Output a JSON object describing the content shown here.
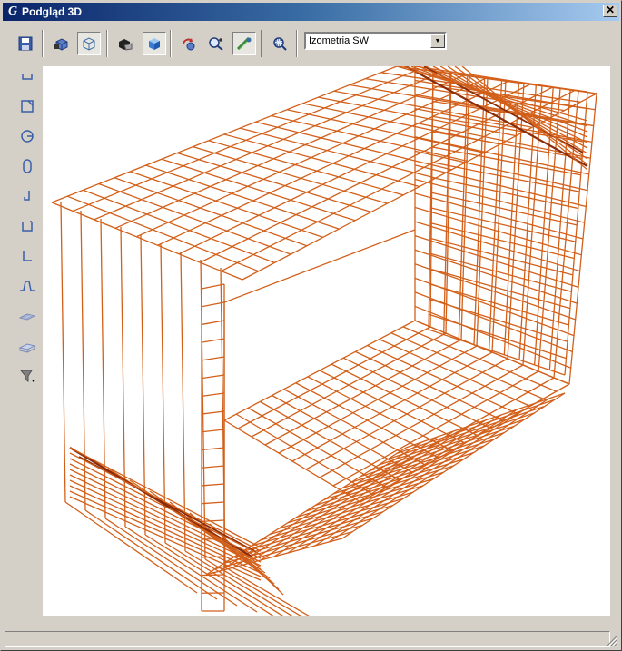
{
  "window": {
    "title": "Podgląd 3D",
    "app_icon_glyph": "G"
  },
  "toolbar": {
    "buttons": [
      {
        "name": "save-icon"
      },
      {
        "name": "view-open-icon"
      },
      {
        "name": "wireframe-cube-icon",
        "pressed": true
      },
      {
        "name": "render-mode-icon"
      },
      {
        "name": "shaded-cube-icon",
        "pressed": true
      },
      {
        "name": "rotate-view-icon"
      },
      {
        "name": "zoom-in-out-icon"
      },
      {
        "name": "pan-hand-icon",
        "pressed": true
      },
      {
        "name": "zoom-extents-icon"
      }
    ],
    "view_select": {
      "value": "Izometria SW"
    }
  },
  "left_tools": [
    {
      "name": "shape-u-icon"
    },
    {
      "name": "shape-square-icon"
    },
    {
      "name": "shape-circle-icon"
    },
    {
      "name": "shape-oval-icon"
    },
    {
      "name": "shape-j-icon"
    },
    {
      "name": "shape-open-square-icon"
    },
    {
      "name": "shape-l-icon"
    },
    {
      "name": "shape-wave-icon"
    },
    {
      "name": "mesh-flat-icon"
    },
    {
      "name": "mesh-3d-icon"
    },
    {
      "name": "filter-icon"
    }
  ],
  "colors": {
    "rebar": "#d2601a",
    "rebar_dark": "#8a2c0a",
    "title_start": "#0a246a",
    "title_end": "#a6caf0"
  }
}
